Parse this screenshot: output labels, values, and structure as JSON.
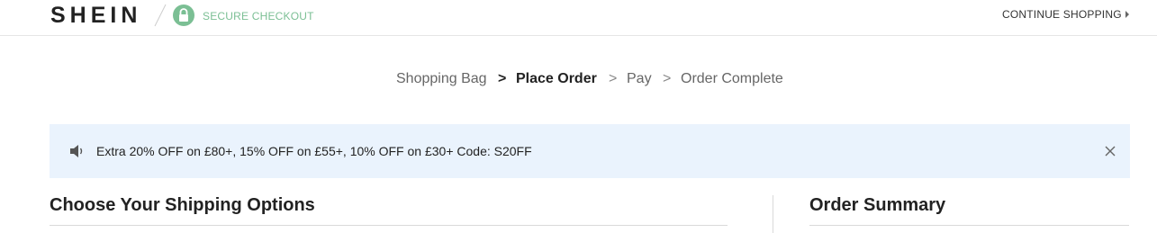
{
  "header": {
    "logo": "SHEIN",
    "secure_label": "SECURE CHECKOUT",
    "continue_label": "CONTINUE SHOPPING",
    "secure_color": "#7bbf94"
  },
  "steps": [
    {
      "label": "Shopping Bag",
      "active": false
    },
    {
      "label": "Place Order",
      "active": true
    },
    {
      "label": "Pay",
      "active": false
    },
    {
      "label": "Order Complete",
      "active": false
    }
  ],
  "step_separator": ">",
  "banner": {
    "text": "Extra 20% OFF on £80+, 15% OFF on £55+, 10% OFF on £30+ Code: S20FF",
    "background": "#eaf3fd"
  },
  "sections": {
    "shipping_title": "Choose Your Shipping Options",
    "summary_title": "Order Summary"
  }
}
